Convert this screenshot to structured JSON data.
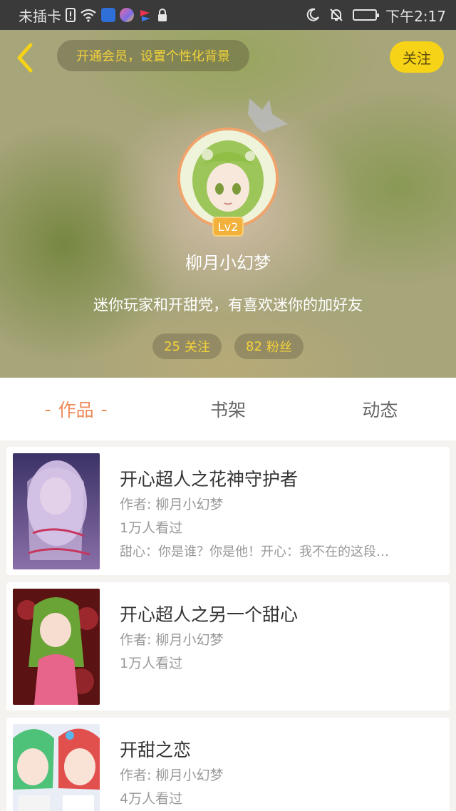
{
  "status_bar": {
    "carrier": "未插卡",
    "time": "下午2:17",
    "icons": [
      "sim-alert-icon",
      "wifi-icon",
      "baidu-paw-icon",
      "app-icon",
      "flag-app-icon",
      "lock-icon",
      "moon-icon",
      "bell-off-icon",
      "battery-icon"
    ]
  },
  "header": {
    "vip_banner": "开通会员，设置个性化背景",
    "follow_button": "关注",
    "level": "Lv2",
    "username": "柳月小幻梦",
    "bio": "迷你玩家和开甜党，有喜欢迷你的加好友",
    "stats": {
      "following_count": "25",
      "following_label": "关注",
      "fans_count": "82",
      "fans_label": "粉丝"
    }
  },
  "tabs": [
    {
      "label": "作品",
      "active": true
    },
    {
      "label": "书架",
      "active": false
    },
    {
      "label": "动态",
      "active": false
    }
  ],
  "works": [
    {
      "title": "开心超人之花神守护者",
      "author": "作者: 柳月小幻梦",
      "views": "1万人看过",
      "summary": "甜心：你是谁？你是他！开心：我不在的这段…"
    },
    {
      "title": "开心超人之另一个甜心",
      "author": "作者: 柳月小幻梦",
      "views": "1万人看过",
      "summary": ""
    },
    {
      "title": "开甜之恋",
      "author": "作者: 柳月小幻梦",
      "views": "4万人看过",
      "summary": ""
    }
  ],
  "colors": {
    "accent": "#ee8a5a",
    "follow_button": "#f7d317",
    "stat_text": "#f5d33a"
  }
}
